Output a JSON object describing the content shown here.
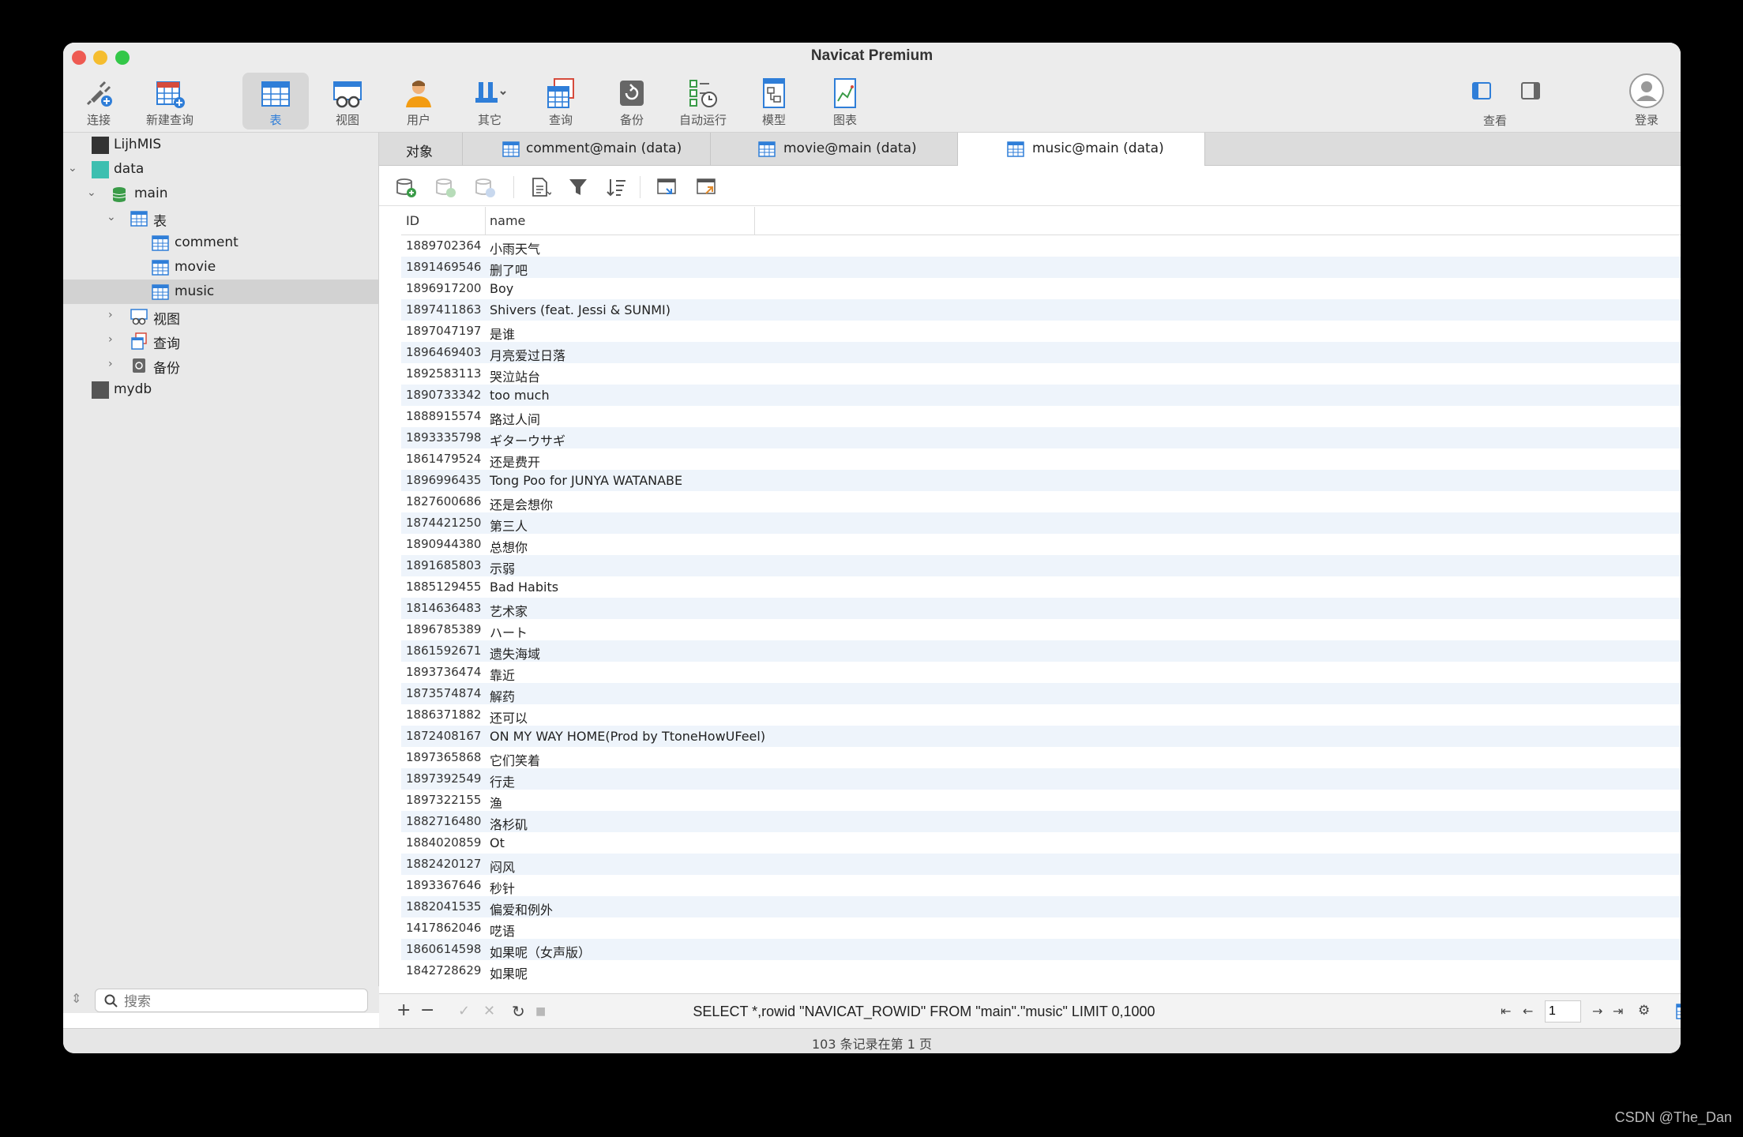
{
  "window": {
    "title": "Navicat Premium"
  },
  "toolbar": {
    "items": [
      {
        "label": "连接",
        "icon": "plug-icon"
      },
      {
        "label": "新建查询",
        "icon": "new-query-icon"
      },
      {
        "label": "表",
        "icon": "table-icon"
      },
      {
        "label": "视图",
        "icon": "view-icon"
      },
      {
        "label": "用户",
        "icon": "user-icon"
      },
      {
        "label": "其它",
        "icon": "tools-icon"
      },
      {
        "label": "查询",
        "icon": "query-icon"
      },
      {
        "label": "备份",
        "icon": "backup-icon"
      },
      {
        "label": "自动运行",
        "icon": "automation-icon"
      },
      {
        "label": "模型",
        "icon": "model-icon"
      },
      {
        "label": "图表",
        "icon": "chart-icon"
      }
    ],
    "view_label": "查看",
    "login_label": "登录"
  },
  "sidebar": {
    "tree": [
      {
        "label": "LijhMIS"
      },
      {
        "label": "data"
      },
      {
        "label": "main"
      },
      {
        "label": "表"
      },
      {
        "label": "comment"
      },
      {
        "label": "movie"
      },
      {
        "label": "music"
      },
      {
        "label": "视图"
      },
      {
        "label": "查询"
      },
      {
        "label": "备份"
      },
      {
        "label": "mydb"
      }
    ],
    "search_placeholder": "搜索"
  },
  "tabs": [
    {
      "label": "对象"
    },
    {
      "label": "comment@main (data)"
    },
    {
      "label": "movie@main (data)"
    },
    {
      "label": "music@main (data)"
    }
  ],
  "grid": {
    "columns": [
      "ID",
      "name"
    ],
    "rows": [
      [
        "1889702364",
        "小雨天气"
      ],
      [
        "1891469546",
        "删了吧"
      ],
      [
        "1896917200",
        "Boy"
      ],
      [
        "1897411863",
        "Shivers (feat. Jessi & SUNMI)"
      ],
      [
        "1897047197",
        "是谁"
      ],
      [
        "1896469403",
        "月亮爱过日落"
      ],
      [
        "1892583113",
        "哭泣站台"
      ],
      [
        "1890733342",
        "too much"
      ],
      [
        "1888915574",
        "路过人间"
      ],
      [
        "1893335798",
        "ギターウサギ"
      ],
      [
        "1861479524",
        "还是费开"
      ],
      [
        "1896996435",
        "Tong Poo for JUNYA WATANABE"
      ],
      [
        "1827600686",
        "还是会想你"
      ],
      [
        "1874421250",
        "第三人"
      ],
      [
        "1890944380",
        "总想你"
      ],
      [
        "1891685803",
        "示弱"
      ],
      [
        "1885129455",
        "Bad Habits"
      ],
      [
        "1814636483",
        "艺术家"
      ],
      [
        "1896785389",
        "ハート"
      ],
      [
        "1861592671",
        "遗失海域"
      ],
      [
        "1893736474",
        "靠近"
      ],
      [
        "1873574874",
        "解药"
      ],
      [
        "1886371882",
        "还可以"
      ],
      [
        "1872408167",
        "ON MY WAY HOME(Prod by TtoneHowUFeel)"
      ],
      [
        "1897365868",
        "它们笑着"
      ],
      [
        "1897392549",
        "行走"
      ],
      [
        "1897322155",
        "渔"
      ],
      [
        "1882716480",
        "洛杉矶"
      ],
      [
        "1884020859",
        "Ot"
      ],
      [
        "1882420127",
        "闷风"
      ],
      [
        "1893367646",
        "秒针"
      ],
      [
        "1882041535",
        "偏爱和例外"
      ],
      [
        "1417862046",
        "呓语"
      ],
      [
        "1860614598",
        "如果呢（女声版）"
      ],
      [
        "1842728629",
        "如果呢"
      ]
    ]
  },
  "query": {
    "sql": "SELECT *,rowid \"NAVICAT_ROWID\" FROM \"main\".\"music\" LIMIT 0,1000",
    "page": "1"
  },
  "status": {
    "text": "103 条记录在第 1 页"
  },
  "watermark": "CSDN @The_Dan",
  "colors": {
    "accent": "#2f7ed8",
    "selected_tree": "#d2d2d2",
    "alt_row": "#eef4fb"
  }
}
